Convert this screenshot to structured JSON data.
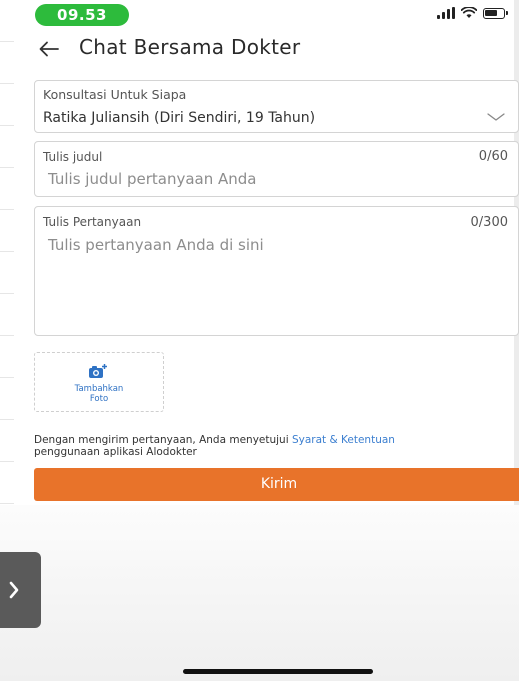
{
  "status_bar": {
    "time": "09.53",
    "icons": [
      "signal-icon",
      "wifi-icon",
      "battery-icon"
    ]
  },
  "header": {
    "back_icon": "arrow-left-icon",
    "title": "Chat Bersama Dokter"
  },
  "form": {
    "patient": {
      "label": "Konsultasi Untuk Siapa",
      "value": "Ratika Juliansih (Diri Sendiri, 19 Tahun)",
      "icon": "chevron-down-icon"
    },
    "title_field": {
      "label": "Tulis judul",
      "placeholder": "Tulis judul pertanyaan Anda",
      "counter": "0/60"
    },
    "question_field": {
      "label": "Tulis Pertanyaan",
      "placeholder": "Tulis pertanyaan Anda di sini",
      "counter": "0/300"
    },
    "photo": {
      "icon": "camera-plus-icon",
      "label_line1": "Tambahkan",
      "label_line2": "Foto"
    },
    "terms": {
      "text": "Dengan mengirim pertanyaan, Anda menyetujui",
      "link": "Syarat & Ketentuan",
      "text2": "penggunaan aplikasi Alodokter"
    },
    "submit_label": "Kirim"
  },
  "side_tab": {
    "icon": "chevron-right-icon"
  },
  "colors": {
    "time_pill": "#2dbb3c",
    "accent": "#e8732a",
    "link": "#3c7fd0"
  }
}
